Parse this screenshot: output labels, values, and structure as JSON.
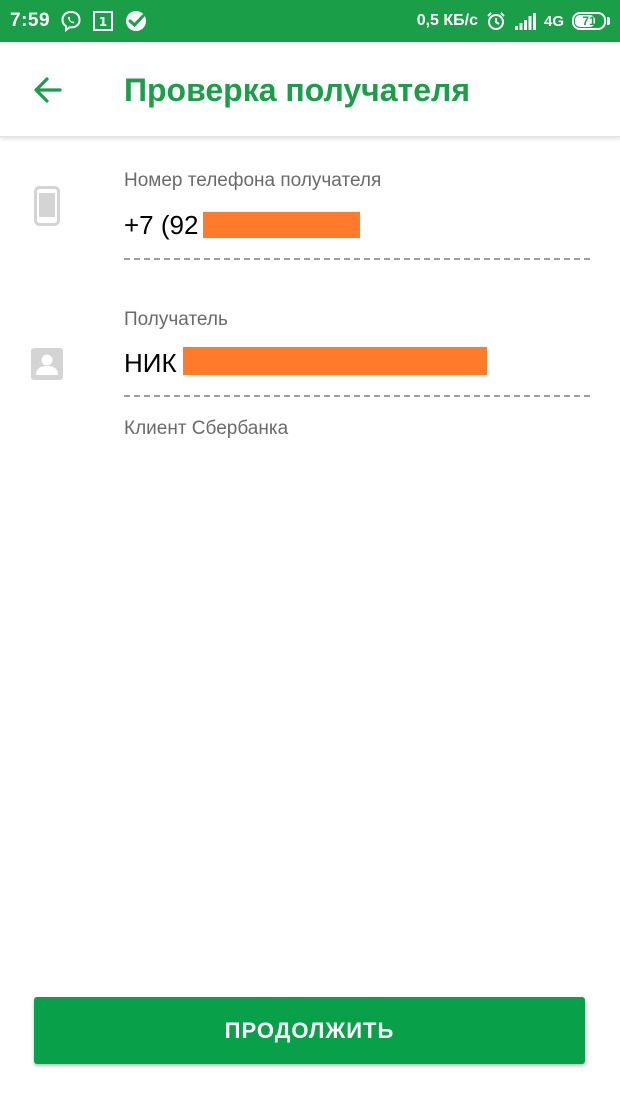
{
  "status_bar": {
    "time": "7:59",
    "notification_count": "1",
    "speed": "0,5 КБ/с",
    "network": "4G",
    "battery_level": "71",
    "battery_fraction": 0.71,
    "background_color": "#1a9e47",
    "icons": [
      "viber-icon",
      "notification-icon",
      "sberbank-logo-icon",
      "alarm-icon",
      "signal-icon"
    ]
  },
  "header": {
    "title": "Проверка получателя",
    "back_icon": "arrow-left-icon",
    "accent_color": "#1a9e47"
  },
  "fields": {
    "phone": {
      "icon": "smartphone-icon",
      "label": "Номер телефона получателя",
      "value": "+7 (92"
    },
    "recipient": {
      "icon": "contact-card-icon",
      "label": "Получатель",
      "value": "НИК",
      "hint": "Клиент Сбербанка"
    },
    "redaction_color": "#ff7a2b"
  },
  "actions": {
    "continue_label": "ПРОДОЛЖИТЬ",
    "continue_color": "#09a04a"
  }
}
